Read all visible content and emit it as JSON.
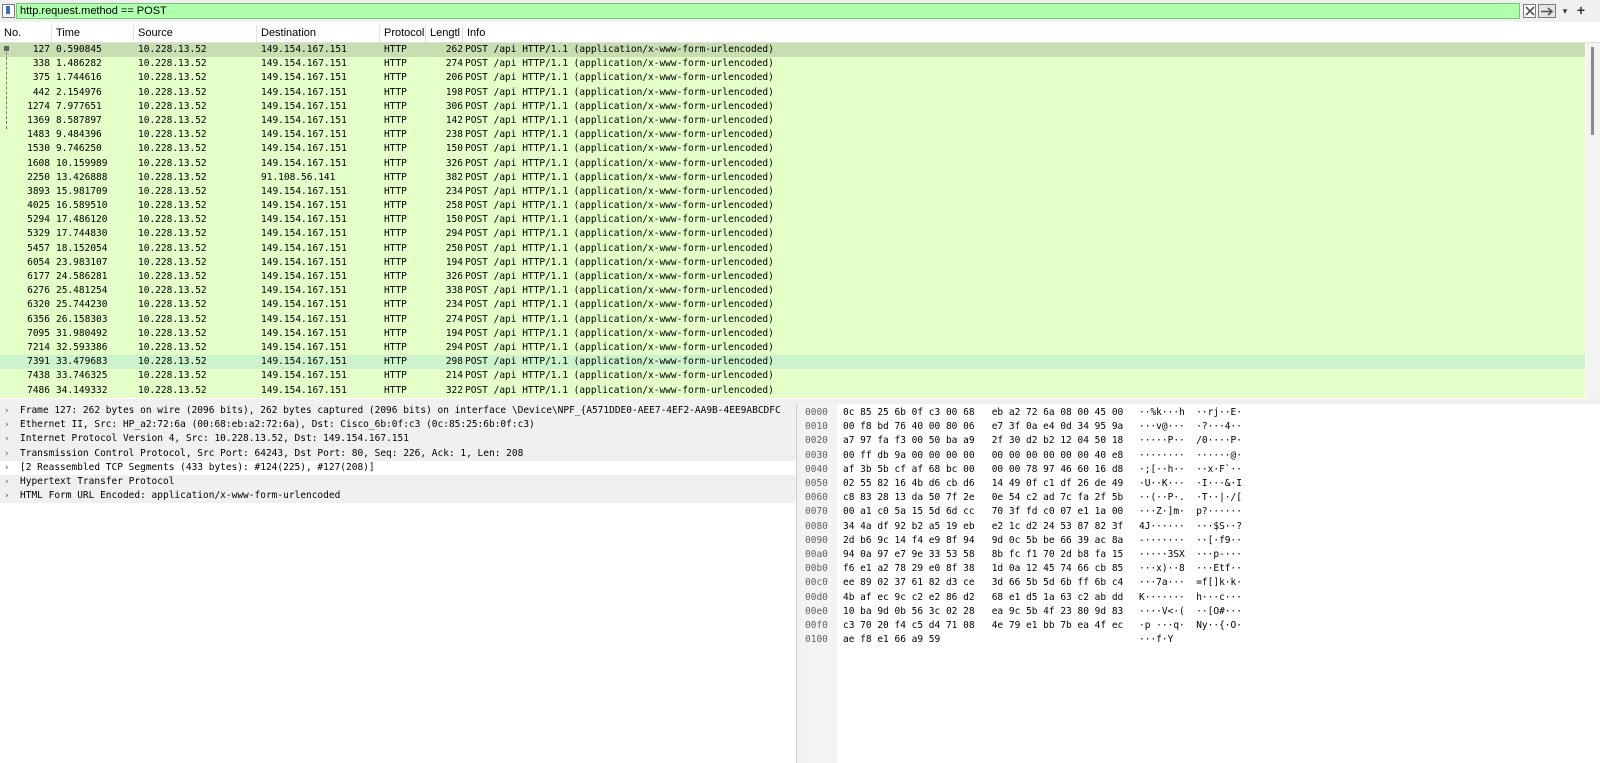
{
  "filter": {
    "value": "http.request.method == POST",
    "bookmark_icon": "bookmark-icon",
    "clear_icon": "close-icon",
    "apply_icon": "arrow-right-icon",
    "dropdown_icon": "chevron-down-icon",
    "add_icon": "plus-icon",
    "colors": {
      "valid_bg": "#afffaf"
    }
  },
  "packet_list": {
    "columns": [
      "No.",
      "Time",
      "Source",
      "Destination",
      "Protocol",
      "Lengtl",
      "Info"
    ],
    "rows": [
      {
        "no": "127",
        "time": "0.590845",
        "src": "10.228.13.52",
        "dst": "149.154.167.151",
        "proto": "HTTP",
        "len": "262",
        "info": "POST /api HTTP/1.1  (application/x-www-form-urlencoded)",
        "state": "selected"
      },
      {
        "no": "338",
        "time": "1.486282",
        "src": "10.228.13.52",
        "dst": "149.154.167.151",
        "proto": "HTTP",
        "len": "274",
        "info": "POST /api HTTP/1.1  (application/x-www-form-urlencoded)",
        "state": ""
      },
      {
        "no": "375",
        "time": "1.744616",
        "src": "10.228.13.52",
        "dst": "149.154.167.151",
        "proto": "HTTP",
        "len": "206",
        "info": "POST /api HTTP/1.1  (application/x-www-form-urlencoded)",
        "state": ""
      },
      {
        "no": "442",
        "time": "2.154976",
        "src": "10.228.13.52",
        "dst": "149.154.167.151",
        "proto": "HTTP",
        "len": "198",
        "info": "POST /api HTTP/1.1  (application/x-www-form-urlencoded)",
        "state": ""
      },
      {
        "no": "1274",
        "time": "7.977651",
        "src": "10.228.13.52",
        "dst": "149.154.167.151",
        "proto": "HTTP",
        "len": "306",
        "info": "POST /api HTTP/1.1  (application/x-www-form-urlencoded)",
        "state": ""
      },
      {
        "no": "1369",
        "time": "8.587897",
        "src": "10.228.13.52",
        "dst": "149.154.167.151",
        "proto": "HTTP",
        "len": "142",
        "info": "POST /api HTTP/1.1  (application/x-www-form-urlencoded)",
        "state": ""
      },
      {
        "no": "1483",
        "time": "9.484396",
        "src": "10.228.13.52",
        "dst": "149.154.167.151",
        "proto": "HTTP",
        "len": "238",
        "info": "POST /api HTTP/1.1  (application/x-www-form-urlencoded)",
        "state": ""
      },
      {
        "no": "1530",
        "time": "9.746250",
        "src": "10.228.13.52",
        "dst": "149.154.167.151",
        "proto": "HTTP",
        "len": "150",
        "info": "POST /api HTTP/1.1  (application/x-www-form-urlencoded)",
        "state": ""
      },
      {
        "no": "1608",
        "time": "10.159989",
        "src": "10.228.13.52",
        "dst": "149.154.167.151",
        "proto": "HTTP",
        "len": "326",
        "info": "POST /api HTTP/1.1  (application/x-www-form-urlencoded)",
        "state": ""
      },
      {
        "no": "2250",
        "time": "13.426888",
        "src": "10.228.13.52",
        "dst": "91.108.56.141",
        "proto": "HTTP",
        "len": "382",
        "info": "POST /api HTTP/1.1  (application/x-www-form-urlencoded)",
        "state": ""
      },
      {
        "no": "3893",
        "time": "15.981709",
        "src": "10.228.13.52",
        "dst": "149.154.167.151",
        "proto": "HTTP",
        "len": "234",
        "info": "POST /api HTTP/1.1  (application/x-www-form-urlencoded)",
        "state": ""
      },
      {
        "no": "4025",
        "time": "16.589510",
        "src": "10.228.13.52",
        "dst": "149.154.167.151",
        "proto": "HTTP",
        "len": "258",
        "info": "POST /api HTTP/1.1  (application/x-www-form-urlencoded)",
        "state": ""
      },
      {
        "no": "5294",
        "time": "17.486120",
        "src": "10.228.13.52",
        "dst": "149.154.167.151",
        "proto": "HTTP",
        "len": "150",
        "info": "POST /api HTTP/1.1  (application/x-www-form-urlencoded)",
        "state": ""
      },
      {
        "no": "5329",
        "time": "17.744830",
        "src": "10.228.13.52",
        "dst": "149.154.167.151",
        "proto": "HTTP",
        "len": "294",
        "info": "POST /api HTTP/1.1  (application/x-www-form-urlencoded)",
        "state": ""
      },
      {
        "no": "5457",
        "time": "18.152054",
        "src": "10.228.13.52",
        "dst": "149.154.167.151",
        "proto": "HTTP",
        "len": "250",
        "info": "POST /api HTTP/1.1  (application/x-www-form-urlencoded)",
        "state": ""
      },
      {
        "no": "6054",
        "time": "23.983107",
        "src": "10.228.13.52",
        "dst": "149.154.167.151",
        "proto": "HTTP",
        "len": "194",
        "info": "POST /api HTTP/1.1  (application/x-www-form-urlencoded)",
        "state": ""
      },
      {
        "no": "6177",
        "time": "24.586281",
        "src": "10.228.13.52",
        "dst": "149.154.167.151",
        "proto": "HTTP",
        "len": "326",
        "info": "POST /api HTTP/1.1  (application/x-www-form-urlencoded)",
        "state": ""
      },
      {
        "no": "6276",
        "time": "25.481254",
        "src": "10.228.13.52",
        "dst": "149.154.167.151",
        "proto": "HTTP",
        "len": "338",
        "info": "POST /api HTTP/1.1  (application/x-www-form-urlencoded)",
        "state": ""
      },
      {
        "no": "6320",
        "time": "25.744230",
        "src": "10.228.13.52",
        "dst": "149.154.167.151",
        "proto": "HTTP",
        "len": "234",
        "info": "POST /api HTTP/1.1  (application/x-www-form-urlencoded)",
        "state": ""
      },
      {
        "no": "6356",
        "time": "26.158303",
        "src": "10.228.13.52",
        "dst": "149.154.167.151",
        "proto": "HTTP",
        "len": "274",
        "info": "POST /api HTTP/1.1  (application/x-www-form-urlencoded)",
        "state": ""
      },
      {
        "no": "7095",
        "time": "31.980492",
        "src": "10.228.13.52",
        "dst": "149.154.167.151",
        "proto": "HTTP",
        "len": "194",
        "info": "POST /api HTTP/1.1  (application/x-www-form-urlencoded)",
        "state": ""
      },
      {
        "no": "7214",
        "time": "32.593386",
        "src": "10.228.13.52",
        "dst": "149.154.167.151",
        "proto": "HTTP",
        "len": "294",
        "info": "POST /api HTTP/1.1  (application/x-www-form-urlencoded)",
        "state": ""
      },
      {
        "no": "7391",
        "time": "33.479683",
        "src": "10.228.13.52",
        "dst": "149.154.167.151",
        "proto": "HTTP",
        "len": "298",
        "info": "POST /api HTTP/1.1  (application/x-www-form-urlencoded)",
        "state": "highlight"
      },
      {
        "no": "7438",
        "time": "33.746325",
        "src": "10.228.13.52",
        "dst": "149.154.167.151",
        "proto": "HTTP",
        "len": "214",
        "info": "POST /api HTTP/1.1  (application/x-www-form-urlencoded)",
        "state": ""
      },
      {
        "no": "7486",
        "time": "34.149332",
        "src": "10.228.13.52",
        "dst": "149.154.167.151",
        "proto": "HTTP",
        "len": "322",
        "info": "POST /api HTTP/1.1  (application/x-www-form-urlencoded)",
        "state": ""
      }
    ],
    "colors": {
      "row_bg": "#e4ffc7",
      "selected_bg": "#c7deb0",
      "highlight_bg": "#cdf3cd"
    }
  },
  "details": {
    "rows": [
      {
        "text": "Frame 127: 262 bytes on wire (2096 bits), 262 bytes captured (2096 bits) on interface \\Device\\NPF_{A571DDE0-AEE7-4EF2-AA9B-4EE9ABCDFC",
        "expandable": true,
        "style": "shaded"
      },
      {
        "text": "Ethernet II, Src: HP_a2:72:6a (00:68:eb:a2:72:6a), Dst: Cisco_6b:0f:c3 (0c:85:25:6b:0f:c3)",
        "expandable": true,
        "style": "shaded"
      },
      {
        "text": "Internet Protocol Version 4, Src: 10.228.13.52, Dst: 149.154.167.151",
        "expandable": true,
        "style": "shaded"
      },
      {
        "text": "Transmission Control Protocol, Src Port: 64243, Dst Port: 80, Seq: 226, Ack: 1, Len: 208",
        "expandable": true,
        "style": "shaded"
      },
      {
        "text": "[2 Reassembled TCP Segments (433 bytes): #124(225), #127(208)]",
        "expandable": true,
        "style": "plain"
      },
      {
        "text": "Hypertext Transfer Protocol",
        "expandable": true,
        "style": "shaded"
      },
      {
        "text": "HTML Form URL Encoded: application/x-www-form-urlencoded",
        "expandable": true,
        "style": "shaded"
      }
    ],
    "chevron_icon": "chevron-right-icon"
  },
  "bytes": {
    "rows": [
      {
        "off": "0000",
        "hex": "0c 85 25 6b 0f c3 00 68   eb a2 72 6a 08 00 45 00",
        "ascii": "··%k···h  ··rj··E·"
      },
      {
        "off": "0010",
        "hex": "00 f8 bd 76 40 00 80 06   e7 3f 0a e4 0d 34 95 9a",
        "ascii": "···v@···  ·?···4··"
      },
      {
        "off": "0020",
        "hex": "a7 97 fa f3 00 50 ba a9   2f 30 d2 b2 12 04 50 18",
        "ascii": "·····P··  /0····P·"
      },
      {
        "off": "0030",
        "hex": "00 ff db 9a 00 00 00 00   00 00 00 00 00 00 40 e8",
        "ascii": "········  ······@·"
      },
      {
        "off": "0040",
        "hex": "af 3b 5b cf af 68 bc 00   00 00 78 97 46 60 16 d8",
        "ascii": "·;[··h··  ··x·F`··"
      },
      {
        "off": "0050",
        "hex": "02 55 82 16 4b d6 cb d6   14 49 0f c1 df 26 de 49",
        "ascii": "·U··K···  ·I···&·I"
      },
      {
        "off": "0060",
        "hex": "c8 83 28 13 da 50 7f 2e   0e 54 c2 ad 7c fa 2f 5b",
        "ascii": "··(··P·.  ·T··|·/["
      },
      {
        "off": "0070",
        "hex": "00 a1 c0 5a 15 5d 6d cc   70 3f fd c0 07 e1 1a 00",
        "ascii": "···Z·]m·  p?······"
      },
      {
        "off": "0080",
        "hex": "34 4a df 92 b2 a5 19 eb   e2 1c d2 24 53 87 82 3f",
        "ascii": "4J······  ···$S··?"
      },
      {
        "off": "0090",
        "hex": "2d b6 9c 14 f4 e9 8f 94   9d 0c 5b be 66 39 ac 8a",
        "ascii": "-·······  ··[·f9··"
      },
      {
        "off": "00a0",
        "hex": "94 0a 97 e7 9e 33 53 58   8b fc f1 70 2d b8 fa 15",
        "ascii": "·····3SX  ···p-···"
      },
      {
        "off": "00b0",
        "hex": "f6 e1 a2 78 29 e0 8f 38   1d 0a 12 45 74 66 cb 85",
        "ascii": "···x)··8  ···Etf··"
      },
      {
        "off": "00c0",
        "hex": "ee 89 02 37 61 82 d3 ce   3d 66 5b 5d 6b ff 6b c4",
        "ascii": "···7a···  =f[]k·k·"
      },
      {
        "off": "00d0",
        "hex": "4b af ec 9c c2 e2 86 d2   68 e1 d5 1a 63 c2 ab dd",
        "ascii": "K·······  h···c···"
      },
      {
        "off": "00e0",
        "hex": "10 ba 9d 0b 56 3c 02 28   ea 9c 5b 4f 23 80 9d 83",
        "ascii": "····V<·(  ··[O#···"
      },
      {
        "off": "00f0",
        "hex": "c3 70 20 f4 c5 d4 71 08   4e 79 e1 bb 7b ea 4f ec",
        "ascii": "·p ···q·  Ny··{·O·"
      },
      {
        "off": "0100",
        "hex": "ae f8 e1 66 a9 59",
        "ascii": "···f·Y"
      }
    ]
  }
}
